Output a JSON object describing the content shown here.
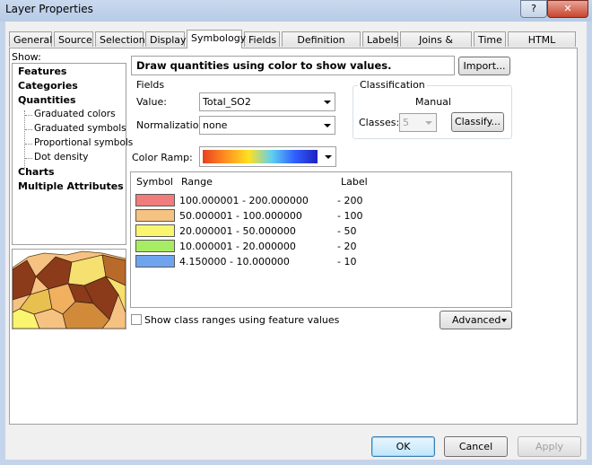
{
  "window": {
    "title": "Layer Properties",
    "help_label": "?",
    "close_label": "✕"
  },
  "tabs": [
    {
      "label": "General"
    },
    {
      "label": "Source"
    },
    {
      "label": "Selection"
    },
    {
      "label": "Display"
    },
    {
      "label": "Symbology",
      "active": true
    },
    {
      "label": "Fields"
    },
    {
      "label": "Definition Query"
    },
    {
      "label": "Labels"
    },
    {
      "label": "Joins & Relates"
    },
    {
      "label": "Time"
    },
    {
      "label": "HTML Popup"
    }
  ],
  "show": {
    "label": "Show:",
    "items": [
      {
        "label": "Features",
        "level": 0
      },
      {
        "label": "Categories",
        "level": 0
      },
      {
        "label": "Quantities",
        "level": 0
      },
      {
        "label": "Graduated colors",
        "level": 1
      },
      {
        "label": "Graduated symbols",
        "level": 1
      },
      {
        "label": "Proportional symbols",
        "level": 1
      },
      {
        "label": "Dot density",
        "level": 1
      },
      {
        "label": "Charts",
        "level": 0
      },
      {
        "label": "Multiple Attributes",
        "level": 0
      }
    ]
  },
  "description": "Draw quantities using color to show values.",
  "import_label": "Import...",
  "fields": {
    "group_label": "Fields",
    "value_label": "Value:",
    "value": "Total_SO2",
    "normalization_label": "Normalization:",
    "normalization": "none"
  },
  "classification": {
    "group_label": "Classification",
    "method": "Manual",
    "classes_label": "Classes:",
    "classes": "5",
    "classify_label": "Classify..."
  },
  "color_ramp_label": "Color Ramp:",
  "table": {
    "headers": {
      "symbol": "Symbol",
      "range": "Range",
      "label": "Label"
    },
    "rows": [
      {
        "range": "100.000001 - 200.000000",
        "label": "- 200",
        "color": "#f07c7c"
      },
      {
        "range": "50.000001 - 100.000000",
        "label": "- 100",
        "color": "#f5c282"
      },
      {
        "range": "20.000001 - 50.000000",
        "label": "- 50",
        "color": "#faf56e"
      },
      {
        "range": "10.000001 - 20.000000",
        "label": "- 20",
        "color": "#a7ec64"
      },
      {
        "range": "4.150000 - 10.000000",
        "label": "- 10",
        "color": "#6ea4ee"
      }
    ]
  },
  "show_ranges_label": "Show class ranges using feature values",
  "advanced_label": "Advanced",
  "buttons": {
    "ok": "OK",
    "cancel": "Cancel",
    "apply": "Apply"
  }
}
